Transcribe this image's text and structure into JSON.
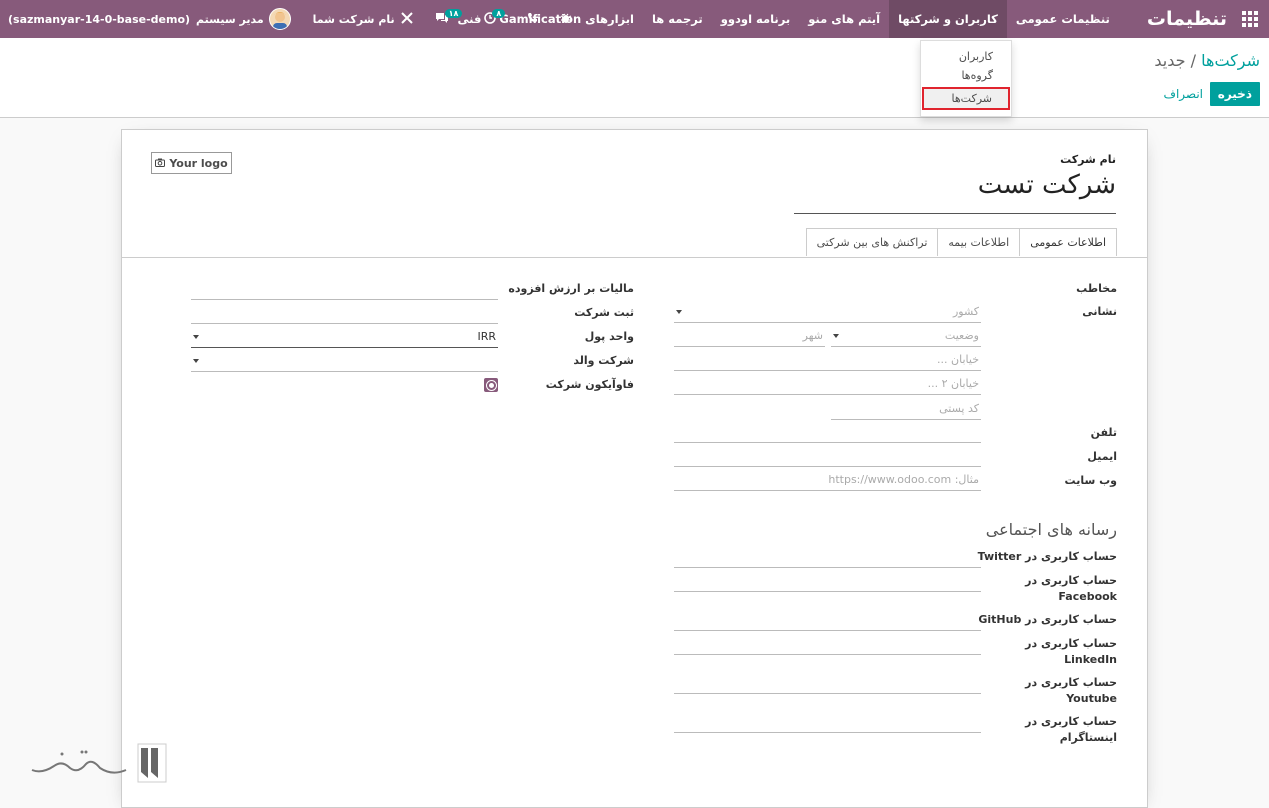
{
  "navbar": {
    "brand": "تنظیمات",
    "menu": [
      {
        "label": "تنظیمات عمومی",
        "active": false
      },
      {
        "label": "کاربران و شرکتها",
        "active": true
      },
      {
        "label": "آیتم های منو",
        "active": false
      },
      {
        "label": "برنامه اودوو",
        "active": false
      },
      {
        "label": "ترجمه ها",
        "active": false
      },
      {
        "label": "ابزارهای Gamification",
        "active": false
      },
      {
        "label": "فنی",
        "active": false
      }
    ],
    "systray": {
      "database": "(sazmanyar-14-0-base-demo)",
      "user_name": "مدیر سیستم",
      "company_name": "نام شرکت شما",
      "messages_count": "۱۸",
      "activities_count": "۸"
    }
  },
  "dropdown": {
    "items": [
      {
        "label": "کاربران",
        "highlighted": false
      },
      {
        "label": "گروه‌ها",
        "highlighted": false
      },
      {
        "label": "شرکت‌ها",
        "highlighted": true
      }
    ]
  },
  "control": {
    "breadcrumb_parent": "شرکت‌ها",
    "breadcrumb_separator": "/",
    "breadcrumb_current": "جدید",
    "save_label": "ذخیره",
    "discard_label": "انصراف"
  },
  "form": {
    "logo_label": "Your logo",
    "name_label": "نام شرکت",
    "name_value": "شرکت تست",
    "tabs": [
      {
        "label": "اطلاعات عمومی",
        "active": true
      },
      {
        "label": "اطلاعات بیمه",
        "active": false
      },
      {
        "label": "تراکنش های بین شرکتی",
        "active": false
      }
    ],
    "right": {
      "contact_label": "مخاطب",
      "address_label": "نشانی",
      "country_placeholder": "کشور",
      "state_placeholder": "وضعیت",
      "city_placeholder": "شهر",
      "street_placeholder": "خیابان ...",
      "street2_placeholder": "خیابان ۲ ...",
      "zip_placeholder": "کد پستی",
      "phone_label": "تلفن",
      "email_label": "ایمیل",
      "website_label": "وب سایت",
      "website_placeholder": "مثال: https://www.odoo.com"
    },
    "left": {
      "vat_label": "مالیات بر ارزش افزوده",
      "registry_label": "ثبت شرکت",
      "currency_label": "واحد پول",
      "currency_value": "IRR",
      "parent_label": "شرکت والد",
      "favicon_label": "فاوآیکون شرکت"
    },
    "social": {
      "title": "رسانه های اجتماعی",
      "twitter": "حساب کاربری در Twitter",
      "facebook_line1": "حساب کاربری در",
      "facebook_line2": "Facebook",
      "github": "حساب کاربری در GitHub",
      "linkedin_line1": "حساب کاربری در",
      "linkedin_line2": "LinkedIn",
      "youtube_line1": "حساب کاربری در",
      "youtube_line2": "Youtube",
      "instagram_line1": "حساب کاربری در",
      "instagram_line2": "اینستاگرام"
    }
  },
  "colors": {
    "navbar": "#875a7b",
    "accent": "#00a09d",
    "highlight_border": "#e0242e"
  }
}
